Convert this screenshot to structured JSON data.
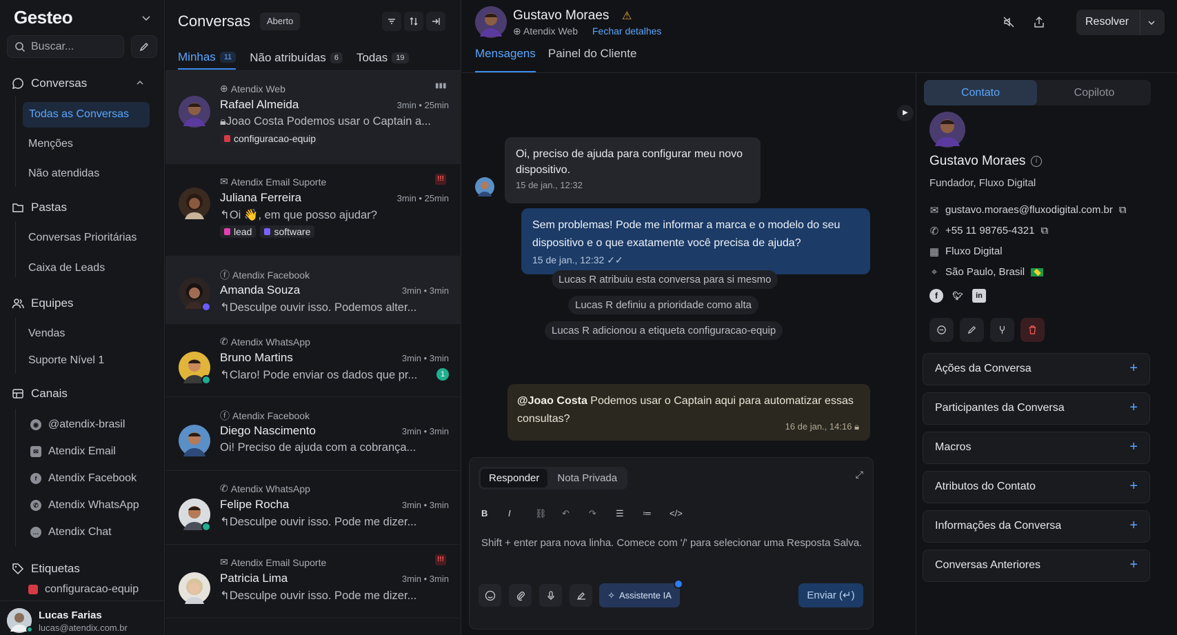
{
  "sidebar": {
    "brand": "Gesteo",
    "search_placeholder": "Buscar...",
    "sections": {
      "conversas": "Conversas",
      "pastas": "Pastas",
      "equipes": "Equipes",
      "canais": "Canais",
      "etiquetas": "Etiquetas"
    },
    "conversas_items": [
      "Todas as Conversas",
      "Menções",
      "Não atendidas"
    ],
    "pastas_items": [
      "Conversas Prioritárias",
      "Caixa de Leads"
    ],
    "equipes_items": [
      "Vendas",
      "Suporte Nível 1"
    ],
    "canais_items": [
      "@atendix-brasil",
      "Atendix Email",
      "Atendix Facebook",
      "Atendix WhatsApp",
      "Atendix Chat"
    ],
    "etiquetas_items": [
      "configuracao-equip"
    ],
    "user": {
      "name": "Lucas Farias",
      "email": "lucas@atendix.com.br"
    }
  },
  "list": {
    "title": "Conversas",
    "status": "Aberto",
    "tabs": [
      {
        "label": "Minhas",
        "count": "11"
      },
      {
        "label": "Não atribuídas",
        "count": "6"
      },
      {
        "label": "Todas",
        "count": "19"
      }
    ],
    "conversations": [
      {
        "inbox": "Atendix Web",
        "name": "Rafael Almeida",
        "time": "3min • 25min",
        "message": "Joao Costa Podemos usar o Captain a...",
        "labels": [
          "configuracao-equip"
        ]
      },
      {
        "inbox": "Atendix Email Suporte",
        "name": "Juliana Ferreira",
        "time": "3min • 25min",
        "message": "Oi 👋, em que posso ajudar?",
        "labels": [
          "lead",
          "software"
        ]
      },
      {
        "inbox": "Atendix Facebook",
        "name": "Amanda Souza",
        "time": "3min • 3min",
        "message": "Desculpe ouvir isso. Podemos alter..."
      },
      {
        "inbox": "Atendix WhatsApp",
        "name": "Bruno Martins",
        "time": "3min • 3min",
        "message": "Claro! Pode enviar os dados que pr...",
        "unread": "1"
      },
      {
        "inbox": "Atendix Facebook",
        "name": "Diego Nascimento",
        "time": "3min • 3min",
        "message": "Oi! Preciso de ajuda com a cobrança..."
      },
      {
        "inbox": "Atendix WhatsApp",
        "name": "Felipe Rocha",
        "time": "3min • 3min",
        "message": "Desculpe ouvir isso. Pode me dizer..."
      },
      {
        "inbox": "Atendix Email Suporte",
        "name": "Patricia Lima",
        "time": "3min • 3min",
        "message": "Desculpe ouvir isso. Pode me dizer..."
      }
    ]
  },
  "header": {
    "name": "Gustavo Moraes",
    "inbox": "Atendix Web",
    "close_details": "Fechar detalhes",
    "resolve": "Resolver",
    "tabs": [
      "Mensagens",
      "Painel do Cliente"
    ]
  },
  "chat": {
    "incoming": {
      "text": "Oi, preciso de ajuda para configurar meu novo dispositivo.",
      "time": "15 de jan., 12:32"
    },
    "outgoing": {
      "text": "Sem problemas! Pode me informar a marca e o modelo do seu dispositivo e o que exatamente você precisa de ajuda?",
      "time": "15 de jan., 12:32"
    },
    "activities": [
      "Lucas R atribuiu esta conversa para si mesmo",
      "Lucas R definiu a prioridade como alta",
      "Lucas R adicionou a etiqueta configuracao-equip"
    ],
    "private": {
      "mention": "@Joao Costa",
      "text": " Podemos usar o Captain aqui para automatizar essas consultas?",
      "time": "16 de jan., 14:16"
    }
  },
  "editor": {
    "tabs": [
      "Responder",
      "Nota Privada"
    ],
    "placeholder": "Shift + enter para nova linha. Comece com '/' para selecionar uma Resposta Salva.",
    "ai": "Assistente IA",
    "send": "Enviar (↵)"
  },
  "panel": {
    "tabs": [
      "Contato",
      "Copiloto"
    ],
    "name": "Gustavo Moraes",
    "role": "Fundador, Fluxo Digital",
    "email": "gustavo.moraes@fluxodigital.com.br",
    "phone": "+55 11 98765-4321",
    "company": "Fluxo Digital",
    "location": "São Paulo, Brasil",
    "accordions": [
      "Ações da Conversa",
      "Participantes da Conversa",
      "Macros",
      "Atributos do Contato",
      "Informações da Conversa",
      "Conversas Anteriores"
    ]
  },
  "colors": {
    "accent": "#3d8ef0",
    "priority_high": "#ff5a5a",
    "whatsapp": "#1fae8f"
  }
}
